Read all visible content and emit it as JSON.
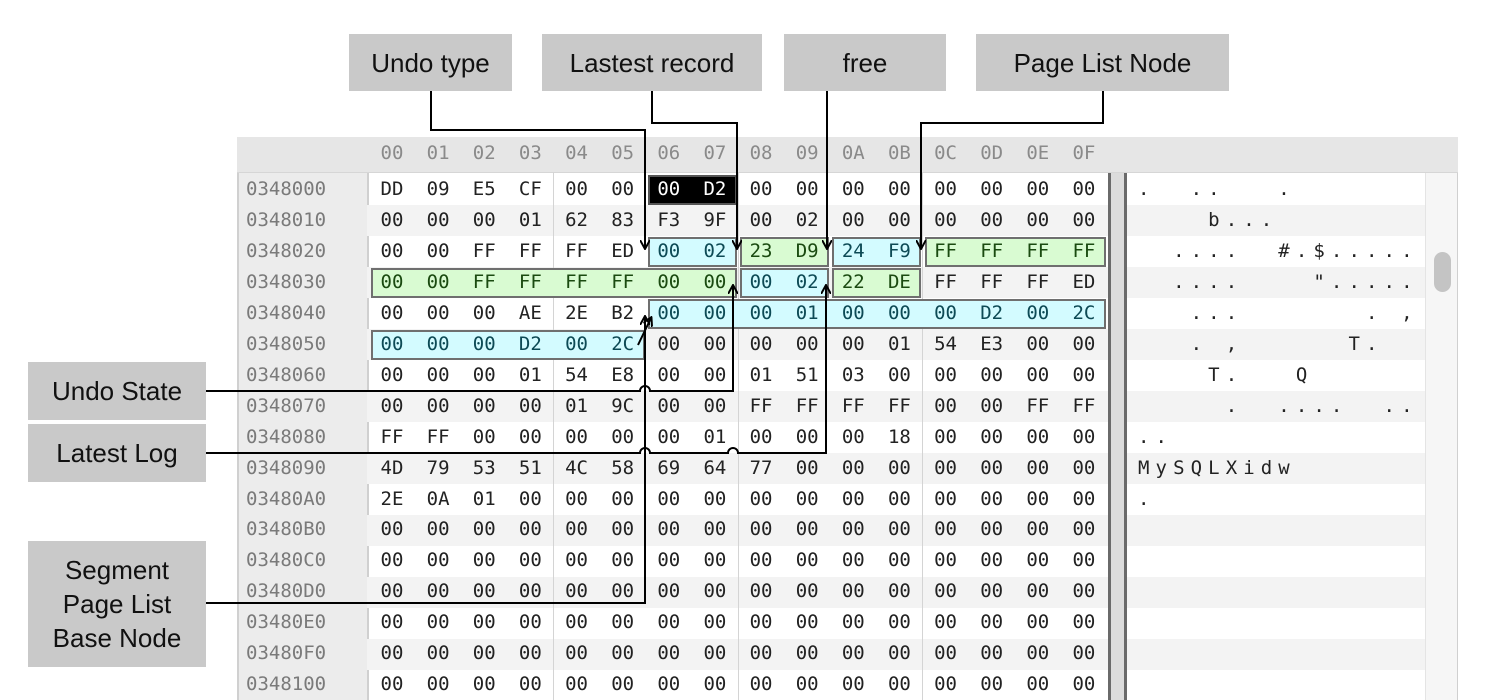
{
  "labels": {
    "undo_type": "Undo type",
    "latest_record": "Lastest record",
    "free": "free",
    "page_list_node": "Page List Node",
    "undo_state": "Undo State",
    "latest_log": "Latest Log",
    "segment_base_node": "Segment Page List Base Node"
  },
  "hex_editor": {
    "column_headers": [
      "00",
      "01",
      "02",
      "03",
      "04",
      "05",
      "06",
      "07",
      "08",
      "09",
      "0A",
      "0B",
      "0C",
      "0D",
      "0E",
      "0F"
    ],
    "rows": [
      {
        "addr": "0348000",
        "bytes": "DD 09 E5 CF 00 00 00 D2 00 00 00 00 00 00 00 00",
        "ascii": ".  ..   ."
      },
      {
        "addr": "0348010",
        "bytes": "00 00 00 01 62 83 F3 9F 00 02 00 00 00 00 00 00",
        "ascii": "    b..."
      },
      {
        "addr": "0348020",
        "bytes": "00 00 FF FF FF ED 00 02 23 D9 24 F9 FF FF FF FF",
        "ascii": "  ....  #.$....."
      },
      {
        "addr": "0348030",
        "bytes": "00 00 FF FF FF FF 00 00 00 02 22 DE FF FF FF ED",
        "ascii": "  ....    \"....."
      },
      {
        "addr": "0348040",
        "bytes": "00 00 00 AE 2E B2 00 00 00 01 00 00 00 D2 00 2C",
        "ascii": "   ...       . ,"
      },
      {
        "addr": "0348050",
        "bytes": "00 00 00 D2 00 2C 00 00 00 00 00 01 54 E3 00 00",
        "ascii": "   . ,      T."
      },
      {
        "addr": "0348060",
        "bytes": "00 00 00 01 54 E8 00 00 01 51 03 00 00 00 00 00",
        "ascii": "    T.   Q"
      },
      {
        "addr": "0348070",
        "bytes": "00 00 00 00 01 9C 00 00 FF FF FF FF 00 00 FF FF",
        "ascii": "     .  ....  .."
      },
      {
        "addr": "0348080",
        "bytes": "FF FF 00 00 00 00 00 01 00 00 00 18 00 00 00 00",
        "ascii": ".."
      },
      {
        "addr": "0348090",
        "bytes": "4D 79 53 51 4C 58 69 64 77 00 00 00 00 00 00 00",
        "ascii": "MySQLXidw"
      },
      {
        "addr": "03480A0",
        "bytes": "2E 0A 01 00 00 00 00 00 00 00 00 00 00 00 00 00",
        "ascii": "."
      },
      {
        "addr": "03480B0",
        "bytes": "00 00 00 00 00 00 00 00 00 00 00 00 00 00 00 00",
        "ascii": ""
      },
      {
        "addr": "03480C0",
        "bytes": "00 00 00 00 00 00 00 00 00 00 00 00 00 00 00 00",
        "ascii": ""
      },
      {
        "addr": "03480D0",
        "bytes": "00 00 00 00 00 00 00 00 00 00 00 00 00 00 00 00",
        "ascii": ""
      },
      {
        "addr": "03480E0",
        "bytes": "00 00 00 00 00 00 00 00 00 00 00 00 00 00 00 00",
        "ascii": ""
      },
      {
        "addr": "03480F0",
        "bytes": "00 00 00 00 00 00 00 00 00 00 00 00 00 00 00 00",
        "ascii": ""
      },
      {
        "addr": "0348100",
        "bytes": "00 00 00 00 00 00 00 00 00 00 00 00 00 00 00 00",
        "ascii": ""
      }
    ],
    "highlights": [
      {
        "row": 0,
        "start": 6,
        "end": 7,
        "color": "selected"
      },
      {
        "row": 2,
        "start": 6,
        "end": 7,
        "color": "cyan"
      },
      {
        "row": 2,
        "start": 8,
        "end": 9,
        "color": "green"
      },
      {
        "row": 2,
        "start": 10,
        "end": 11,
        "color": "cyan"
      },
      {
        "row": 2,
        "start": 12,
        "end": 15,
        "color": "green"
      },
      {
        "row": 3,
        "start": 0,
        "end": 7,
        "color": "green"
      },
      {
        "row": 3,
        "start": 8,
        "end": 9,
        "color": "cyan"
      },
      {
        "row": 3,
        "start": 10,
        "end": 11,
        "color": "green"
      },
      {
        "row": 4,
        "start": 6,
        "end": 15,
        "color": "cyan"
      },
      {
        "row": 5,
        "start": 0,
        "end": 5,
        "color": "cyan"
      }
    ]
  },
  "colors": {
    "cyan": "#d3fbff",
    "green": "#d9fbd2",
    "selected": "#000000",
    "label_bg": "#c9c9c9"
  }
}
